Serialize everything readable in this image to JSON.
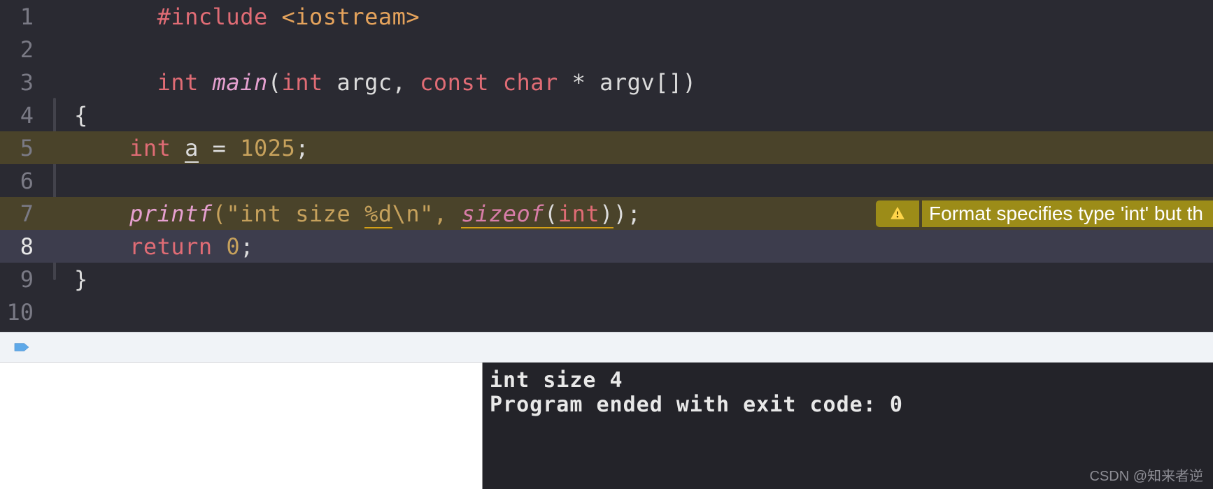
{
  "lines": {
    "l1": {
      "preproc": "#include",
      "header": "<iostream>"
    },
    "l3": {
      "kw_int": "int",
      "func": "main",
      "kw_int2": "int",
      "argc": "argc",
      "comma": ", ",
      "kw_const": "const",
      "kw_char": "char",
      "star": " * ",
      "argv": "argv",
      "brackets": "[]"
    },
    "l4": {
      "brace": "{"
    },
    "l5": {
      "kw_int": "int",
      "a": "a",
      "eq": " = ",
      "num": "1025",
      "semi": ";"
    },
    "l7": {
      "printf": "printf",
      "str_open": "(\"",
      "str_body": "int size ",
      "fmt": "%d",
      "esc": "\\n",
      "str_close": "\", ",
      "sizeof": "sizeof",
      "sizeof_open": "(",
      "sizeof_arg": "int",
      "sizeof_close": ")",
      "close_paren": ")",
      "semi": ";"
    },
    "l8": {
      "kw_return": "return",
      "num": "0",
      "semi": ";"
    },
    "l9": {
      "brace": "}"
    }
  },
  "line_numbers": [
    "1",
    "2",
    "3",
    "4",
    "5",
    "6",
    "7",
    "8",
    "9",
    "10"
  ],
  "warning": {
    "text": "Format specifies type 'int' but th"
  },
  "console": {
    "line1": "int size 4",
    "line2": "Program ended with exit code: 0"
  },
  "watermark": "CSDN @知来者逆"
}
